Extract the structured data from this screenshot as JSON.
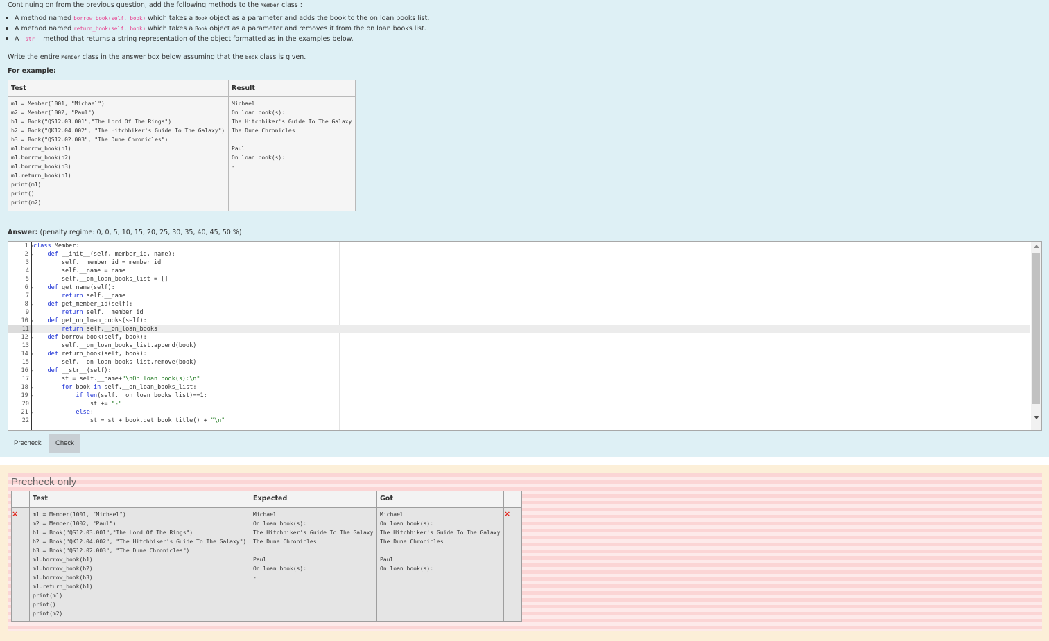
{
  "question": {
    "intro": "Continuing on from the previous question, add the following methods to the",
    "intro_class": "Member",
    "intro_end": "class :",
    "bullets": [
      {
        "pre": "A method named",
        "code": "borrow_book(self, book)",
        "mid": "which takes a",
        "code2": "Book",
        "post": "object as a parameter and adds the book to the on loan books list."
      },
      {
        "pre": "A method named",
        "code": "return_book(self, book)",
        "mid": "which takes a",
        "code2": "Book",
        "post": "object as a parameter and removes it from the on loan books list."
      },
      {
        "pre": "A",
        "code": "__str__",
        "mid": "method that returns a string representation of the object formatted as in the examples below.",
        "code2": "",
        "post": ""
      }
    ],
    "write_pre": "Write the entire",
    "write_code": "Member",
    "write_mid": "class in the answer box below assuming that the",
    "write_code2": "Book",
    "write_post": "class is given.",
    "for_example": "For example:"
  },
  "example_table": {
    "headers": [
      "Test",
      "Result"
    ],
    "test": "m1 = Member(1001, \"Michael\")\nm2 = Member(1002, \"Paul\")\nb1 = Book(\"QS12.03.001\",\"The Lord Of The Rings\")\nb2 = Book(\"QK12.04.002\", \"The Hitchhiker's Guide To The Galaxy\")\nb3 = Book(\"QS12.02.003\", \"The Dune Chronicles\")\nm1.borrow_book(b1)\nm1.borrow_book(b2)\nm1.borrow_book(b3)\nm1.return_book(b1)\nprint(m1)\nprint()\nprint(m2)",
    "result": "Michael\nOn loan book(s):\nThe Hitchhiker's Guide To The Galaxy\nThe Dune Chronicles\n\nPaul\nOn loan book(s):\n-"
  },
  "answer": {
    "label": "Answer:",
    "penalty": "(penalty regime: 0, 0, 5, 10, 15, 20, 25, 30, 35, 40, 45, 50 %)",
    "line_numbers": [
      "1",
      "2",
      "3",
      "4",
      "5",
      "6",
      "7",
      "8",
      "9",
      "10",
      "11",
      "12",
      "13",
      "14",
      "15",
      "16",
      "17",
      "18",
      "19",
      "20",
      "21",
      "22"
    ],
    "fold_lines": [
      1,
      2,
      6,
      8,
      10,
      12,
      14,
      16,
      18,
      19,
      21
    ],
    "active_line": 11,
    "code_lines": [
      "class Member:",
      "    def __init__(self, member_id, name):",
      "        self.__member_id = member_id",
      "        self.__name = name",
      "        self.__on_loan_books_list = []",
      "    def get_name(self):",
      "        return self.__name",
      "    def get_member_id(self):",
      "        return self.__member_id",
      "    def get_on_loan_books(self):",
      "        return self.__on_loan_books",
      "    def borrow_book(self, book):",
      "        self.__on_loan_books_list.append(book)",
      "    def return_book(self, book):",
      "        self.__on_loan_books_list.remove(book)",
      "    def __str__(self):",
      "        st = self.__name+\"\\nOn loan book(s):\\n\"",
      "        for book in self.__on_loan_books_list:",
      "            if len(self.__on_loan_books_list)==1:",
      "                st += \"-\"",
      "            else:",
      "                st = st + book.get_book_title() + \"\\n\""
    ]
  },
  "buttons": {
    "precheck": "Precheck",
    "check": "Check"
  },
  "precheck": {
    "title": "Precheck only",
    "headers": [
      "",
      "Test",
      "Expected",
      "Got",
      ""
    ],
    "mark": "×",
    "test": "m1 = Member(1001, \"Michael\")\nm2 = Member(1002, \"Paul\")\nb1 = Book(\"QS12.03.001\",\"The Lord Of The Rings\")\nb2 = Book(\"QK12.04.002\", \"The Hitchhiker's Guide To The Galaxy\")\nb3 = Book(\"QS12.02.003\", \"The Dune Chronicles\")\nm1.borrow_book(b1)\nm1.borrow_book(b2)\nm1.borrow_book(b3)\nm1.return_book(b1)\nprint(m1)\nprint()\nprint(m2)",
    "expected": "Michael\nOn loan book(s):\nThe Hitchhiker's Guide To The Galaxy\nThe Dune Chronicles\n\nPaul\nOn loan book(s):\n-",
    "got": "Michael\nOn loan book(s):\nThe Hitchhiker's Guide To The Galaxy\nThe Dune Chronicles\n\nPaul\nOn loan book(s):"
  },
  "colors": {
    "error": "#e2231a",
    "keyword": "#1f33d6",
    "string": "#217a21",
    "inline_code": "#e83e8c"
  }
}
